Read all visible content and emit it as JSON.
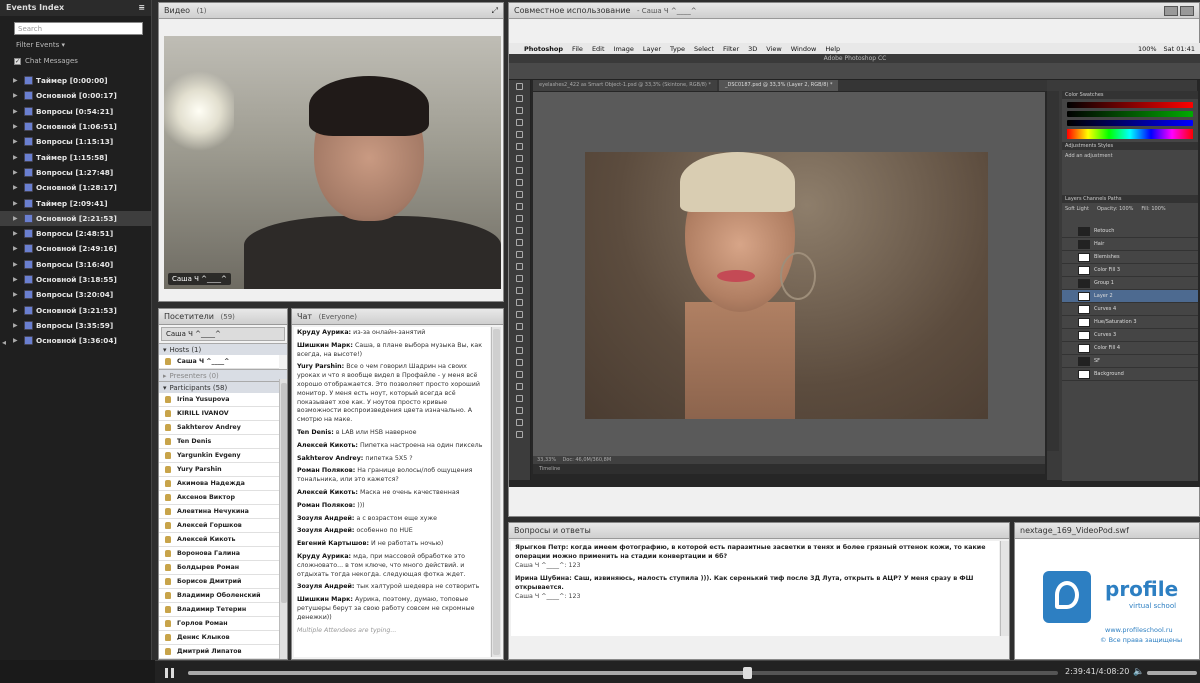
{
  "events": {
    "title": "Events Index",
    "search_placeholder": "Search",
    "filter_label": "Filter Events",
    "chat_messages_label": "Chat Messages",
    "items": [
      {
        "label": "Таймер [0:00:00]",
        "selected": false
      },
      {
        "label": "Основной [0:00:17]",
        "selected": false
      },
      {
        "label": "Вопросы [0:54:21]",
        "selected": false
      },
      {
        "label": "Основной [1:06:51]",
        "selected": false
      },
      {
        "label": "Вопросы [1:15:13]",
        "selected": false
      },
      {
        "label": "Таймер [1:15:58]",
        "selected": false
      },
      {
        "label": "Вопросы [1:27:48]",
        "selected": false
      },
      {
        "label": "Основной [1:28:17]",
        "selected": false
      },
      {
        "label": "Таймер [2:09:41]",
        "selected": false
      },
      {
        "label": "Основной [2:21:53]",
        "selected": true
      },
      {
        "label": "Вопросы [2:48:51]",
        "selected": false
      },
      {
        "label": "Основной [2:49:16]",
        "selected": false
      },
      {
        "label": "Вопросы [3:16:40]",
        "selected": false
      },
      {
        "label": "Основной [3:18:55]",
        "selected": false
      },
      {
        "label": "Вопросы [3:20:04]",
        "selected": false
      },
      {
        "label": "Основной [3:21:53]",
        "selected": false
      },
      {
        "label": "Вопросы [3:35:59]",
        "selected": false
      },
      {
        "label": "Основной [3:36:04]",
        "selected": false
      }
    ]
  },
  "video": {
    "title": "Видео",
    "count": "(1)",
    "name_tag": "Саша Ч ^____^"
  },
  "attendees": {
    "title": "Посетители",
    "count": "(59)",
    "me": "Саша Ч ^____^",
    "hosts_label": "Hosts (1)",
    "host_name": "Саша Ч ^____^",
    "presenters_label": "Presenters (0)",
    "participants_label": "Participants (58)",
    "participants": [
      "Irina Yusupova",
      "KIRILL IVANOV",
      "Sakhterov Andrey",
      "Ten Denis",
      "Yargunkin Evgeny",
      "Yury Parshin",
      "Акимова Надежда",
      "Аксенов Виктор",
      "Алевтина Нечукина",
      "Алексей Горшков",
      "Алексей Кикоть",
      "Воронова Галина",
      "Болдырев Роман",
      "Борисов Дмитрий",
      "Владимир Оболенский",
      "Владимир Тетерин",
      "Горлов Роман",
      "Денис Клыков",
      "Дмитрий Липатов"
    ]
  },
  "chat": {
    "title": "Чат",
    "scope": "(Everyone)",
    "messages": [
      {
        "who": "Круду Аурика:",
        "text": "из-за онлайн-занятий"
      },
      {
        "who": "Шишкин Марк:",
        "text": "Саша, в плане выбора музыка Вы, как всегда, на высоте!)"
      },
      {
        "who": "Yury Parshin:",
        "text": "Все о чем говорил Шадрин на своих уроках и что я вообще видел в Профайле - у меня всё хорошо отображается. Это позволяет просто хороший монитор. У меня есть ноут, который всегда всё показывает хое как. У ноутов просто кривые возможности воспроизведения цвета изначально. А смотрю на маке."
      },
      {
        "who": "Ten Denis:",
        "text": "в LAB или HSB наверное"
      },
      {
        "who": "Алексей Кикоть:",
        "text": "Пипетка настроена на один пиксель"
      },
      {
        "who": "Sakhterov Andrey:",
        "text": "пипетка 5Х5 ?"
      },
      {
        "who": "Роман Поляков:",
        "text": "На границе волосы/лоб ощущения тональника, или это кажется?"
      },
      {
        "who": "Алексей Кикоть:",
        "text": "Маска не очень качественная"
      },
      {
        "who": "Роман Поляков:",
        "text": ")))"
      },
      {
        "who": "Зозуля Андрей:",
        "text": "а с возрастом еще хуже"
      },
      {
        "who": "Зозуля Андрей:",
        "text": "особенно по HUE"
      },
      {
        "who": "Евгений Картышов:",
        "text": "И не работать ночью)"
      },
      {
        "who": "Круду Аурика:",
        "text": "мда, при массовой обработке это сложновато... в том ключе, что много действий. и отдыхать тогда некогда. следующая фотка ждет."
      },
      {
        "who": "Зозуля Андрей:",
        "text": "тык халтурой шедевра не сотворить"
      },
      {
        "who": "Шишкин Марк:",
        "text": "Аурика, поэтому, думаю, топовые ретушеры берут за свою работу совсем не скромные денежки))"
      }
    ],
    "typing": "Multiple Attendees are typing..."
  },
  "share": {
    "title": "Совместное использование",
    "presenter": "- Саша Ч ^____^",
    "mac_menu": [
      "Photoshop",
      "File",
      "Edit",
      "Image",
      "Layer",
      "Type",
      "Select",
      "Filter",
      "3D",
      "View",
      "Window",
      "Help"
    ],
    "mac_right": [
      "100%",
      "Sat 01:41"
    ],
    "ps_title": "Adobe Photoshop CC",
    "doc_tabs": [
      "eyelashes2_422 as Smart Object-1.psd @ 33,3% (Skintone, RGB/8) *",
      "_DSC0187.psd @ 33,3% (Layer 2, RGB/8) *"
    ],
    "zoom": "33,33%",
    "doc_info": "Doc: 46,0M/360,8M",
    "timeline": "Timeline",
    "panels": {
      "color_tabs": "Color  Swatches",
      "adjust_tabs": "Adjustments  Styles",
      "adjust_hint": "Add an adjustment",
      "layers_tabs": "Layers  Channels  Paths",
      "blend": "Soft Light",
      "opacity": "Opacity: 100%",
      "fill": "Fill: 100%"
    },
    "layers": [
      {
        "name": "Retouch",
        "dark": true,
        "sel": false
      },
      {
        "name": "Hair",
        "dark": true,
        "sel": false
      },
      {
        "name": "Blemishes",
        "dark": false,
        "sel": false
      },
      {
        "name": "Color Fill 3",
        "dark": false,
        "sel": false
      },
      {
        "name": "Group 1",
        "dark": true,
        "sel": false
      },
      {
        "name": "Layer 2",
        "dark": false,
        "sel": true
      },
      {
        "name": "Curves 4",
        "dark": false,
        "sel": false
      },
      {
        "name": "Hue/Saturation 3",
        "dark": false,
        "sel": false
      },
      {
        "name": "Curves 3",
        "dark": false,
        "sel": false
      },
      {
        "name": "Color Fill 4",
        "dark": false,
        "sel": false
      },
      {
        "name": "SF",
        "dark": true,
        "sel": false
      },
      {
        "name": "Background",
        "dark": false,
        "sel": false
      }
    ]
  },
  "qa": {
    "title": "Вопросы и ответы",
    "items": [
      {
        "q": "Ярыгков Петр: когда имеем фотографию, в которой есть паразитные засветки в тенях и более грязный оттенок кожи, то какие операции можно применить на стадии конвертации и 6б?",
        "a": "Саша Ч ^____^: 123"
      },
      {
        "q": "Ирина Шубина: Саш, извиняюсь, малость ступила ))). Как серенький тиф после 3Д Лута, открыть в АЦР? У меня сразу в ФШ открывается.",
        "a": "Саша Ч ^____^: 123"
      }
    ]
  },
  "pod": {
    "title": "nextage_169_VideoPod.swf",
    "brand": "profile",
    "brand_sub": "virtual school",
    "url": "www.profileschool.ru",
    "copyright": "© Все права защищены"
  },
  "player": {
    "time": "2:39:41/4:08:20",
    "progress": 0.643
  }
}
